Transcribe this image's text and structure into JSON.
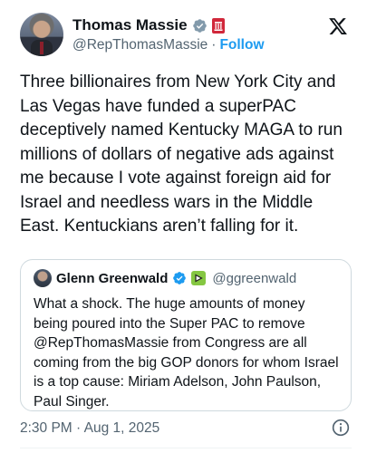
{
  "post": {
    "author_name": "Thomas Massie",
    "author_handle": "@RepThomasMassie",
    "separator": "·",
    "follow_label": "Follow",
    "text": "Three billionaires from New York City and Las Vegas have funded a superPAC deceptively named Kentucky MAGA to run millions of dollars of negative ads against me because I vote against foreign aid for Israel and needless wars in the Middle East. Kentuckians aren’t falling for it.",
    "timestamp": "2:30 PM · Aug 1, 2025"
  },
  "quoted_post": {
    "author_name": "Glenn Greenwald",
    "author_handle": "@ggreenwald",
    "text": "What a shock. The huge amounts of money being poured into the Super PAC to remove @RepThomasMassie from Congress are all coming from the big GOP donors for whom Israel is a top cause: Miriam Adelson, John Paulson, Paul Singer."
  },
  "icons": {
    "verified": "verified-badge-icon",
    "flag": "us-house-flag-icon",
    "platform": "x-logo-icon",
    "rumble": "rumble-icon",
    "info": "info-icon"
  },
  "colors": {
    "accent": "#1d9bf0",
    "text": "#0f1419",
    "muted": "#536471",
    "border": "#cfd9de"
  }
}
